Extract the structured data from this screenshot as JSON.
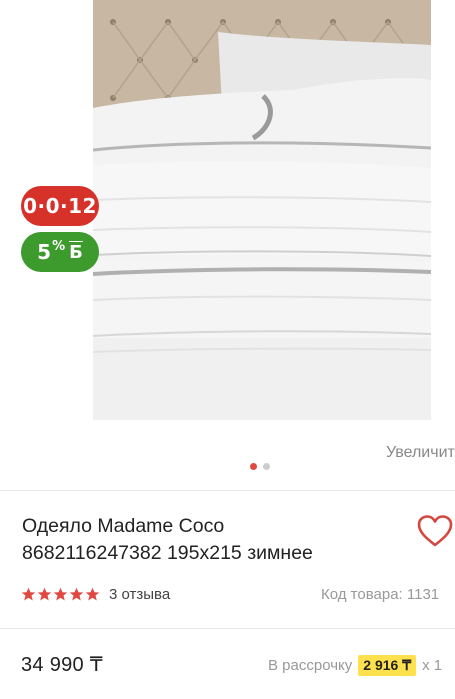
{
  "gallery": {
    "badge_installment": "0·0·12",
    "badge_bonus_value": "5",
    "badge_bonus_percent": "%",
    "badge_bonus_letter": "Б",
    "zoom_label": "Увеличит",
    "dots_count": 2,
    "active_dot": 1
  },
  "product": {
    "title_line1": "Одеяло Madame Coco",
    "title_line2": "8682116247382 195х215 зимнее",
    "rating": 5,
    "reviews": "3 отзыва",
    "sku": "Код товара: 1131"
  },
  "pricing": {
    "price": "34 990 ₸",
    "installment_label": "В рассрочку",
    "installment_amount": "2 916 ₸",
    "installment_multiplier": "x 1"
  },
  "colors": {
    "installment_badge": "#d6322a",
    "bonus_badge": "#3d9a2c",
    "accent": "#e0493f",
    "highlight": "#ffe14d"
  }
}
